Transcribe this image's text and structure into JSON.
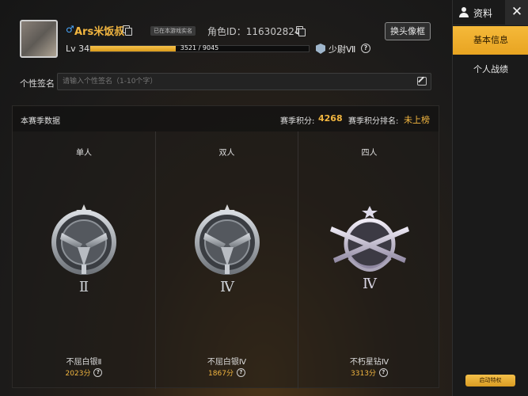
{
  "profile": {
    "gender_symbol": "♂",
    "username": "Ars米饭叔",
    "status_tag": "已在本游戏实名",
    "role_id": "角色ID：116302824",
    "change_avatar_label": "换头像框",
    "level": "Lv 34",
    "xp_text": "3521 / 9045",
    "xp_progress": 0.39,
    "rank_label": "少尉Ⅶ"
  },
  "signature": {
    "label": "个性签名",
    "placeholder": "请输入个性签名（1-10个字）"
  },
  "season": {
    "title": "本赛季数据",
    "score_label": "赛季积分:",
    "score_value": "4268",
    "rank_label": "赛季积分排名:",
    "rank_value": "未上榜",
    "modes": [
      {
        "title": "单人",
        "tier": "不屈白银Ⅱ",
        "points": "2023分",
        "emblem": "silver-pistols-emblem",
        "numeral": "Ⅱ"
      },
      {
        "title": "双人",
        "tier": "不屈白银Ⅳ",
        "points": "1867分",
        "emblem": "silver-pistols-emblem",
        "numeral": "Ⅳ"
      },
      {
        "title": "四人",
        "tier": "不朽星钻Ⅳ",
        "points": "3313分",
        "emblem": "diamond-rifles-emblem",
        "numeral": "Ⅳ"
      }
    ]
  },
  "sidebar": {
    "title": "资料",
    "close_symbol": "✕",
    "tabs": [
      {
        "label": "基本信息",
        "active": true
      },
      {
        "label": "个人战绩",
        "active": false
      }
    ],
    "privilege_label": "启动特权"
  },
  "colors": {
    "accent": "#f2b640",
    "username": "#f2b640",
    "active_tab": "#f5b93a"
  }
}
